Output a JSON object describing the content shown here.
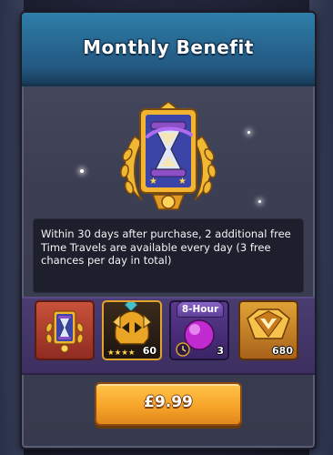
{
  "dialog": {
    "title": "Monthly Benefit",
    "description": "Within 30 days after purchase, 2 additional free Time Travels are available every day (3 free chances per day in total)"
  },
  "rewards": [
    {
      "name": "time-travel-card",
      "quantity": ""
    },
    {
      "name": "golden-helmet-hero",
      "quantity": "60",
      "stars": 4
    },
    {
      "name": "purple-orb-timer",
      "badge": "8-Hour",
      "quantity": "3"
    },
    {
      "name": "gold-gem-chest",
      "quantity": "680"
    }
  ],
  "purchase": {
    "price_label": "£9.99"
  },
  "colors": {
    "header_blue": "#2e7fa8",
    "button_orange": "#f7a52a",
    "reward_strip_purple": "#4a3c70"
  }
}
